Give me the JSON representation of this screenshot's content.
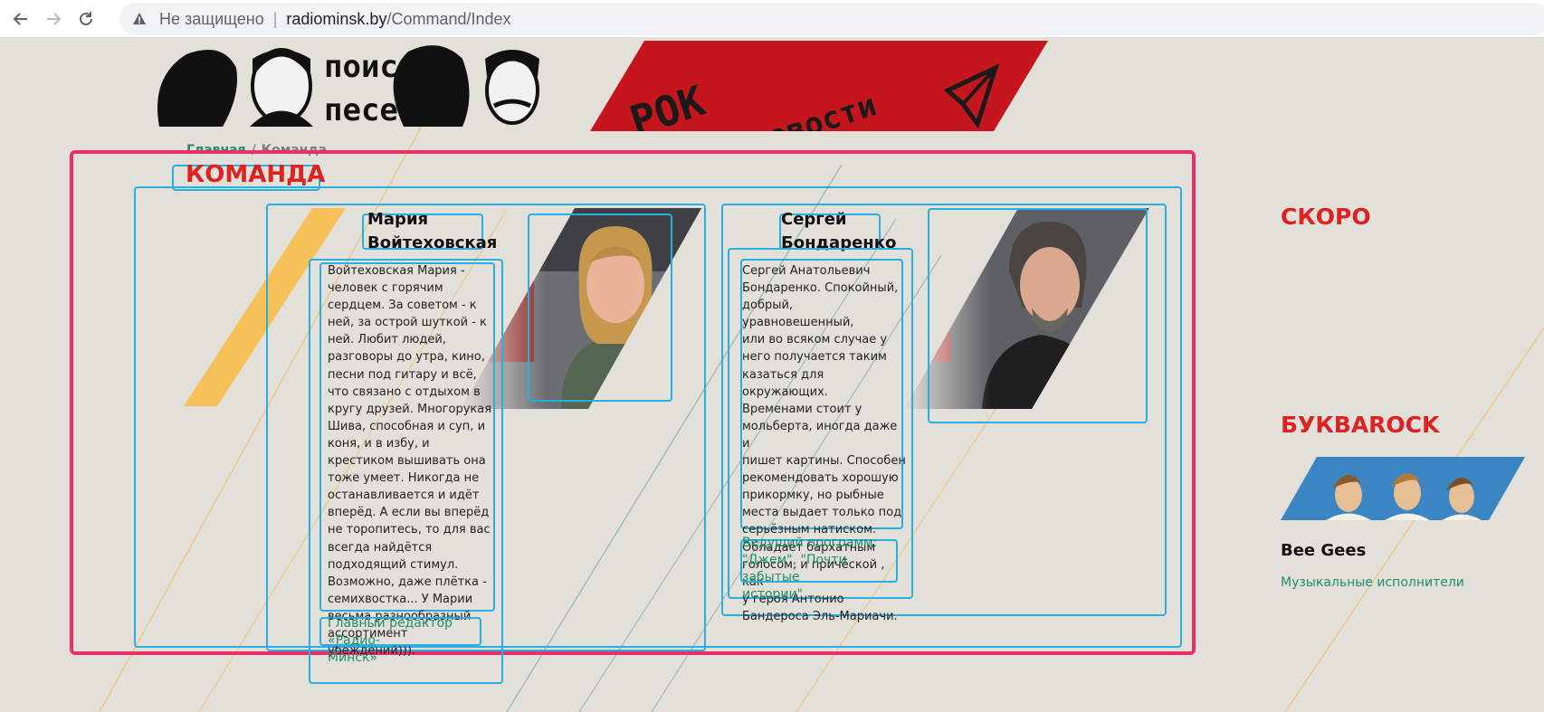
{
  "browser": {
    "security_label": "Не защищено",
    "url_host": "radiominsk.by",
    "url_path": "/Command/Index"
  },
  "banner": {
    "left_text": [
      "поиск",
      "песен"
    ],
    "right_text": [
      "РОК",
      "новости"
    ]
  },
  "breadcrumb": {
    "home": "Главная",
    "separator": "/",
    "current": "Команда"
  },
  "main": {
    "heading": "КОМАНДА",
    "team": [
      {
        "name_line1": "Мария",
        "name_line2": "Войтеховская",
        "bio_lines": [
          "Войтеховская Мария -",
          "человек с горячим",
          "сердцем. За советом - к",
          "ней, за острой шуткой - к",
          "ней. Любит людей,",
          "разговоры до утра, кино,",
          "песни под гитару и всё,",
          "что связано с отдыхом в",
          "кругу друзей. Многорукая",
          "Шива, способная и суп, и",
          "коня, и в избу, и",
          "крестиком вышивать она",
          "тоже умеет. Никогда не",
          "останавливается и идёт",
          "вперёд. А если вы вперёд",
          "не торопитесь, то для вас",
          "всегда найдётся",
          "подходящий стимул.",
          "Возможно, даже плётка -",
          "семихвостка... У Марии",
          "весьма разнообразный",
          "ассортимент убеждений)))."
        ],
        "role_lines": [
          "Главный редактор «Радио-",
          "Минск»"
        ]
      },
      {
        "name_line1": "Сергей",
        "name_line2": "Бондаренко",
        "bio_lines": [
          "Сергей Анатольевич",
          "Бондаренко. Спокойный,",
          "добрый, уравновешенный,",
          "или во всяком случае у",
          "него получается таким",
          "казаться для окружающих.",
          "Временами стоит у",
          "мольберта, иногда даже и",
          "пишет картины. Способен",
          "рекомендовать хорошую",
          "прикормку, но рыбные",
          "места выдает только под",
          "серьёзным натиском.",
          "Обладает бархатным",
          "голосом, и причёской , как",
          "у героя Антонио",
          "Бандероса Эль-Мариачи."
        ],
        "role_lines": [
          "Ведущий программ:",
          "\"Джем\", \"Почти забытые",
          "истории\""
        ]
      }
    ]
  },
  "sidebar": {
    "soon_heading": "СКОРО",
    "bukva_heading": "БУКВАROCK",
    "feature_title": "Bee Gees",
    "feature_category": "Музыкальные исполнители"
  },
  "colors": {
    "background": "#e3dfd9",
    "accent_red": "#dd2222",
    "link_green": "#1e8f6a",
    "bbox_blue": "#2aaee0",
    "main_box_pink": "#e8306a"
  }
}
